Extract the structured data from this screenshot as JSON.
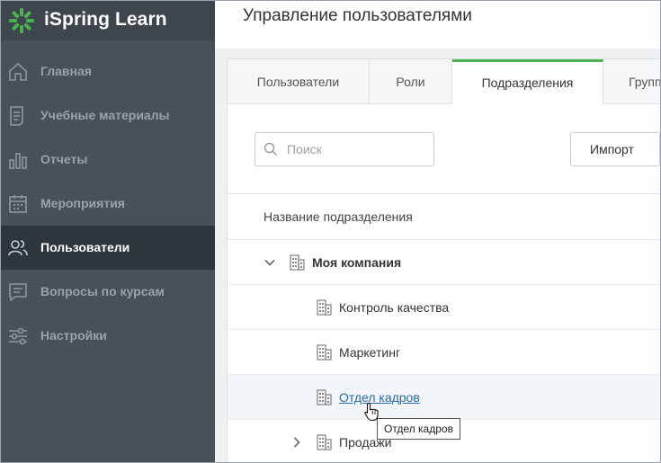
{
  "app": {
    "name": "iSpring Learn",
    "brand_color": "#4caf50"
  },
  "sidebar": {
    "items": [
      {
        "label": "Главная",
        "icon": "home-icon",
        "active": false
      },
      {
        "label": "Учебные материалы",
        "icon": "document-icon",
        "active": false
      },
      {
        "label": "Отчеты",
        "icon": "bar-chart-icon",
        "active": false
      },
      {
        "label": "Мероприятия",
        "icon": "calendar-icon",
        "active": false
      },
      {
        "label": "Пользователи",
        "icon": "users-icon",
        "active": true
      },
      {
        "label": "Вопросы по курсам",
        "icon": "chat-icon",
        "active": false
      },
      {
        "label": "Настройки",
        "icon": "sliders-icon",
        "active": false
      }
    ]
  },
  "header": {
    "title": "Управление пользователями"
  },
  "tabs": [
    {
      "label": "Пользователи",
      "active": false
    },
    {
      "label": "Роли",
      "active": false
    },
    {
      "label": "Подразделения",
      "active": true
    },
    {
      "label": "Групп",
      "active": false
    }
  ],
  "search": {
    "placeholder": "Поиск",
    "value": ""
  },
  "toolbar": {
    "import_label": "Импорт"
  },
  "table": {
    "column_header": "Название подразделения",
    "rows": [
      {
        "label": "Моя компания",
        "level": 0,
        "expanded": true
      },
      {
        "label": "Контроль качества",
        "level": 1
      },
      {
        "label": "Маркетинг",
        "level": 1
      },
      {
        "label": "Отдел кадров",
        "level": 1,
        "hovered": true
      },
      {
        "label": "Продажи",
        "level": 1,
        "expanded": false
      }
    ]
  },
  "tooltip": {
    "text": "Отдел кадров"
  }
}
